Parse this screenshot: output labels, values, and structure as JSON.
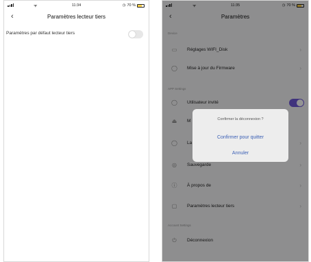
{
  "left": {
    "status": {
      "time": "11:34",
      "battery": "70 %"
    },
    "nav": {
      "back": "‹",
      "title": "Paramètres lecteur tiers"
    },
    "setting": {
      "label": "Paramètres par défaut lecteur tiers",
      "enabled": false
    }
  },
  "right": {
    "status": {
      "time": "11:35",
      "battery": "70 %"
    },
    "nav": {
      "back": "‹",
      "title": "Paramètres"
    },
    "sections": {
      "device": "Device",
      "app": "APP Settings",
      "account": "Account Settings"
    },
    "items": {
      "wifi": "Réglages WIFI_Disk",
      "firmware": "Mise à jour du Firmware",
      "guest": "Utilisateur invité",
      "m_partial": "M",
      "la_partial": "La",
      "backup": "Sauvegarde",
      "about": "À propos de",
      "third_party": "Paramètres lecteur tiers",
      "logout": "Déconnexion"
    },
    "guest_enabled": true,
    "dialog": {
      "message": "Confirmer la déconnexion ?",
      "confirm": "Confirmer pour quitter",
      "cancel": "Annuler"
    }
  },
  "colors": {
    "accent": "#6f58d8",
    "link": "#3a5fb5"
  }
}
